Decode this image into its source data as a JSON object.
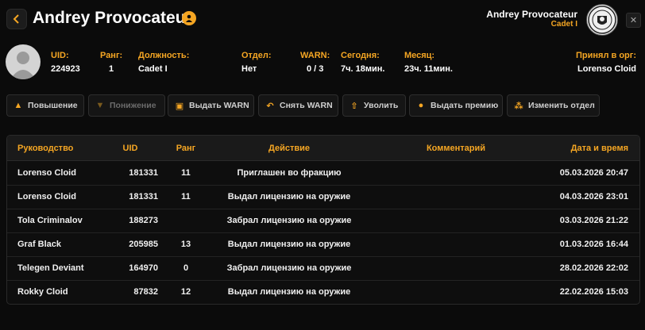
{
  "header": {
    "title": "Andrey Provocateur",
    "user_name": "Andrey Provocateur",
    "user_rank": "Cadet I"
  },
  "profile": {
    "fields": [
      {
        "label": "UID:",
        "value": "224923"
      },
      {
        "label": "Ранг:",
        "value": "1"
      },
      {
        "label": "Должность:",
        "value": "Cadet I"
      },
      {
        "label": "Отдел:",
        "value": "Нет"
      },
      {
        "label": "WARN:",
        "value": "0 / 3"
      },
      {
        "label": "Сегодня:",
        "value": "7ч. 18мин."
      },
      {
        "label": "Месяц:",
        "value": "23ч. 11мин."
      },
      {
        "label": "Принял в орг:",
        "value": "Lorenso Cloid"
      }
    ]
  },
  "actions": [
    {
      "label": "Повышение",
      "icon": "chevron-up-icon"
    },
    {
      "label": "Понижение",
      "icon": "chevron-down-icon"
    },
    {
      "label": "Выдать WARN",
      "icon": "warn-document-icon"
    },
    {
      "label": "Снять WARN",
      "icon": "undo-arrow-icon"
    },
    {
      "label": "Уволить",
      "icon": "fire-person-icon"
    },
    {
      "label": "Выдать премию",
      "icon": "coin-icon"
    },
    {
      "label": "Изменить отдел",
      "icon": "hierarchy-icon"
    }
  ],
  "table": {
    "columns": [
      "Руководство",
      "UID",
      "Ранг",
      "Действие",
      "Комментарий",
      "Дата и время"
    ],
    "rows": [
      {
        "lead": "Lorenso Cloid",
        "uid": "181331",
        "rank": "11",
        "action": "Приглашен во фракцию",
        "comment": "",
        "date": "05.03.2026 20:47"
      },
      {
        "lead": "Lorenso Cloid",
        "uid": "181331",
        "rank": "11",
        "action": "Выдал лицензию на оружие",
        "comment": "",
        "date": "04.03.2026 23:01"
      },
      {
        "lead": "Tola Criminalov",
        "uid": "188273",
        "rank": "",
        "action": "Забрал лицензию на оружие",
        "comment": "",
        "date": "03.03.2026 21:22"
      },
      {
        "lead": "Graf Black",
        "uid": "205985",
        "rank": "13",
        "action": "Выдал лицензию на оружие",
        "comment": "",
        "date": "01.03.2026 16:44"
      },
      {
        "lead": "Telegen Deviant",
        "uid": "164970",
        "rank": "0",
        "action": "Забрал лицензию на оружие",
        "comment": "",
        "date": "28.02.2026 22:02"
      },
      {
        "lead": "Rokky Cloid",
        "uid": "87832",
        "rank": "12",
        "action": "Выдал лицензию на оружие",
        "comment": "",
        "date": "22.02.2026 15:03"
      }
    ]
  },
  "colors": {
    "accent": "#f5a623",
    "background": "#0b0b0b"
  }
}
